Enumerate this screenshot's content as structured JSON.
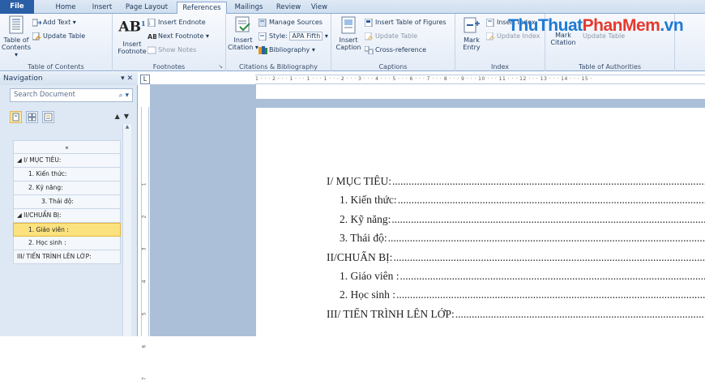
{
  "tabs": [
    "File",
    "Home",
    "Insert",
    "Page Layout",
    "References",
    "Mailings",
    "Review",
    "View"
  ],
  "watermark": {
    "part1": "ThuThuat",
    "part2": "PhanMem",
    "part3": ".vn"
  },
  "ribbon": {
    "toc": {
      "table_of_contents": "Table of",
      "table_of_contents_2": "Contents",
      "add_text": "Add Text",
      "update_table": "Update Table",
      "label": "Table of Contents"
    },
    "footnotes": {
      "insert_footnote": "Insert",
      "insert_footnote_2": "Footnote",
      "insert_endnote": "Insert Endnote",
      "next_footnote": "Next Footnote",
      "show_notes": "Show Notes",
      "label": "Footnotes",
      "ab": "AB",
      "sup": "1"
    },
    "citations": {
      "insert_citation": "Insert",
      "insert_citation_2": "Citation",
      "manage_sources": "Manage Sources",
      "style_label": "Style:",
      "style_value": "APA Fifth",
      "bibliography": "Bibliography",
      "label": "Citations & Bibliography"
    },
    "captions": {
      "insert_caption": "Insert",
      "insert_caption_2": "Caption",
      "insert_table_of_figures": "Insert Table of Figures",
      "update_table": "Update Table",
      "cross_reference": "Cross-reference",
      "label": "Captions"
    },
    "index": {
      "mark_entry": "Mark",
      "mark_entry_2": "Entry",
      "insert_index": "Insert Index",
      "update_index": "Update Index",
      "label": "Index"
    },
    "authorities": {
      "mark_citation": "Mark",
      "mark_citation_2": "Citation",
      "update_table": "Update Table",
      "label": "Table of Authorities"
    }
  },
  "navigation": {
    "title": "Navigation",
    "search_placeholder": "Search Document",
    "headings": [
      {
        "label": "I/ MỤC TIÊU:",
        "level": 1,
        "selected": false
      },
      {
        "label": "1. Kiến thức:",
        "level": 2,
        "selected": false
      },
      {
        "label": "2. Kỹ năng:",
        "level": 2,
        "selected": false
      },
      {
        "label": "3. Thái độ:",
        "level": 3,
        "selected": false
      },
      {
        "label": "II/CHUẨN BỊ:",
        "level": 1,
        "selected": false
      },
      {
        "label": "1. Giáo viên :",
        "level": 2,
        "selected": true
      },
      {
        "label": "2. Học sinh :",
        "level": 2,
        "selected": false
      },
      {
        "label": "III/ TIẾN TRÌNH LÊN LỚP:",
        "level": 1,
        "selected": false
      }
    ]
  },
  "ruler": {
    "ticks": "1 · · · 2 · · · 1 · · · 1 · · · 1 · · · 2 · · · 3 · · · 4 · · · 5 · · · 6 · · · 7 · · · 8 · · · 9 · · · 10 · · · 11 · · · 12 · · · 13 · · · 14 · · · 15 ·",
    "left_numbers": [
      "1",
      "2",
      "3",
      "4",
      "5",
      "6",
      "7"
    ]
  },
  "document": {
    "lines": [
      {
        "text": "I/ MỤC TIÊU:",
        "indent": 0
      },
      {
        "text": "1. Kiến thức:",
        "indent": 1
      },
      {
        "text": "2. Kỹ năng:",
        "indent": 1
      },
      {
        "text": "3. Thái độ:",
        "indent": 1
      },
      {
        "text": "II/CHUẨN BỊ:",
        "indent": 0
      },
      {
        "text": "1.  Giáo viên  :",
        "indent": 1
      },
      {
        "text": "2.  Học sinh :",
        "indent": 1
      },
      {
        "text": "III/ TIẾN TRÌNH LÊN LỚP:",
        "indent": 0
      }
    ]
  },
  "colors": {
    "accent": "#2a5ea6",
    "selection": "#fbe27f",
    "workspace": "#acbfd8"
  }
}
